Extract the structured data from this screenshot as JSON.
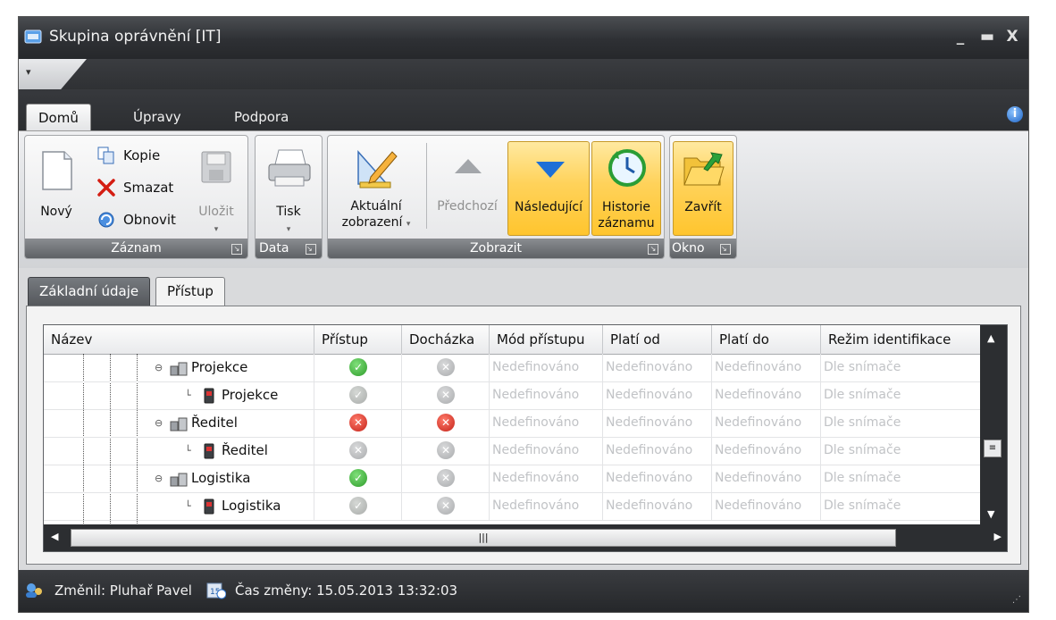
{
  "window": {
    "title": "Skupina oprávnění [IT]"
  },
  "ribbon": {
    "tabs": [
      {
        "label": "Domů"
      },
      {
        "label": "Úpravy"
      },
      {
        "label": "Podpora"
      }
    ],
    "groups": {
      "zaznam": {
        "label": "Záznam",
        "new": "Nový",
        "copy": "Kopie",
        "delete": "Smazat",
        "refresh": "Obnovit",
        "save": "Uložit"
      },
      "data": {
        "label": "Data",
        "print": "Tisk"
      },
      "zobrazit": {
        "label": "Zobrazit",
        "current_line1": "Aktuální",
        "current_line2": "zobrazení",
        "prev": "Předchozí",
        "next": "Následující",
        "history_line1": "Historie",
        "history_line2": "záznamu"
      },
      "okno": {
        "label": "Okno",
        "close": "Zavřít"
      }
    }
  },
  "content": {
    "tabs": [
      {
        "label": "Základní údaje"
      },
      {
        "label": "Přístup"
      }
    ],
    "columns": [
      "Název",
      "Přístup",
      "Docházka",
      "Mód přístupu",
      "Platí od",
      "Platí do",
      "Režim identifikace"
    ],
    "rows": [
      {
        "name": "Projekce",
        "type": "group",
        "access": "ok",
        "attendance": "no-dim",
        "mode": "Nedefinováno",
        "from": "Nedefinováno",
        "to": "Nedefinováno",
        "ident": "Dle snímače"
      },
      {
        "name": "Projekce",
        "type": "item",
        "access": "ok-dim",
        "attendance": "no-dim",
        "mode": "Nedefinováno",
        "from": "Nedefinováno",
        "to": "Nedefinováno",
        "ident": "Dle snímače"
      },
      {
        "name": "Ředitel",
        "type": "group",
        "access": "no",
        "attendance": "no",
        "mode": "Nedefinováno",
        "from": "Nedefinováno",
        "to": "Nedefinováno",
        "ident": "Dle snímače"
      },
      {
        "name": "Ředitel",
        "type": "item",
        "access": "no-dim",
        "attendance": "no-dim",
        "mode": "Nedefinováno",
        "from": "Nedefinováno",
        "to": "Nedefinováno",
        "ident": "Dle snímače"
      },
      {
        "name": "Logistika",
        "type": "group",
        "access": "ok",
        "attendance": "no-dim",
        "mode": "Nedefinováno",
        "from": "Nedefinováno",
        "to": "Nedefinováno",
        "ident": "Dle snímače"
      },
      {
        "name": "Logistika",
        "type": "item",
        "access": "ok-dim",
        "attendance": "no-dim",
        "mode": "Nedefinováno",
        "from": "Nedefinováno",
        "to": "Nedefinováno",
        "ident": "Dle snímače"
      }
    ]
  },
  "status": {
    "changed_by": "Změnil: Pluhař Pavel",
    "changed_at": "Čas změny: 15.05.2013 13:32:03"
  }
}
